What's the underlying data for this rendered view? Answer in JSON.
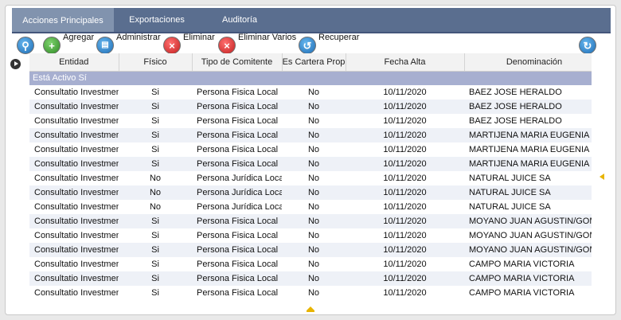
{
  "tabs": [
    {
      "label": "Acciones Principales"
    },
    {
      "label": "Exportaciones"
    },
    {
      "label": "Auditoría"
    }
  ],
  "toolbar": {
    "search_icon": "search-icon",
    "add_label": "Agregar",
    "admin_label": "Administrar",
    "delete_label": "Eliminar",
    "delete_many_label": "Eliminar Varios",
    "recover_label": "Recuperar",
    "refresh_icon": "refresh-icon"
  },
  "grid": {
    "columns": [
      "Entidad",
      "Físico",
      "Tipo de Comitente",
      "Es Cartera Prop",
      "Fecha Alta",
      "Denominación"
    ],
    "group_label": "Está Activo Sí",
    "rows": [
      [
        "Consultatio Investments",
        "Si",
        "Persona Fisica Local",
        "No",
        "10/11/2020",
        "BAEZ JOSE HERALDO"
      ],
      [
        "Consultatio Investments",
        "Si",
        "Persona Fisica Local",
        "No",
        "10/11/2020",
        "BAEZ JOSE HERALDO"
      ],
      [
        "Consultatio Investments",
        "Si",
        "Persona Fisica Local",
        "No",
        "10/11/2020",
        "BAEZ JOSE HERALDO"
      ],
      [
        "Consultatio Investments",
        "Si",
        "Persona Fisica Local",
        "No",
        "10/11/2020",
        "MARTIJENA MARIA EUGENIA"
      ],
      [
        "Consultatio Investments",
        "Si",
        "Persona Fisica Local",
        "No",
        "10/11/2020",
        "MARTIJENA MARIA EUGENIA"
      ],
      [
        "Consultatio Investments",
        "Si",
        "Persona Fisica Local",
        "No",
        "10/11/2020",
        "MARTIJENA MARIA EUGENIA"
      ],
      [
        "Consultatio Investments",
        "No",
        "Persona Jurídica Local",
        "No",
        "10/11/2020",
        "NATURAL JUICE SA"
      ],
      [
        "Consultatio Investments",
        "No",
        "Persona Jurídica Local",
        "No",
        "10/11/2020",
        "NATURAL JUICE SA"
      ],
      [
        "Consultatio Investments",
        "No",
        "Persona Jurídica Local",
        "No",
        "10/11/2020",
        "NATURAL JUICE SA"
      ],
      [
        "Consultatio Investments",
        "Si",
        "Persona Fisica Local",
        "No",
        "10/11/2020",
        "MOYANO JUAN AGUSTIN/GOME"
      ],
      [
        "Consultatio Investments",
        "Si",
        "Persona Fisica Local",
        "No",
        "10/11/2020",
        "MOYANO JUAN AGUSTIN/GOME"
      ],
      [
        "Consultatio Investments",
        "Si",
        "Persona Fisica Local",
        "No",
        "10/11/2020",
        "MOYANO JUAN AGUSTIN/GOME"
      ],
      [
        "Consultatio Investments",
        "Si",
        "Persona Fisica Local",
        "No",
        "10/11/2020",
        "CAMPO MARIA VICTORIA"
      ],
      [
        "Consultatio Investments",
        "Si",
        "Persona Fisica Local",
        "No",
        "10/11/2020",
        "CAMPO MARIA VICTORIA"
      ],
      [
        "Consultatio Investments",
        "Si",
        "Persona Fisica Local",
        "No",
        "10/11/2020",
        "CAMPO MARIA VICTORIA"
      ]
    ]
  },
  "colors": {
    "tabbar": "#5a6e8f",
    "active_tab": "#8193ae",
    "group_row": "#a7afd0",
    "alt_row": "#eef1f7",
    "handle": "#e8b400"
  }
}
